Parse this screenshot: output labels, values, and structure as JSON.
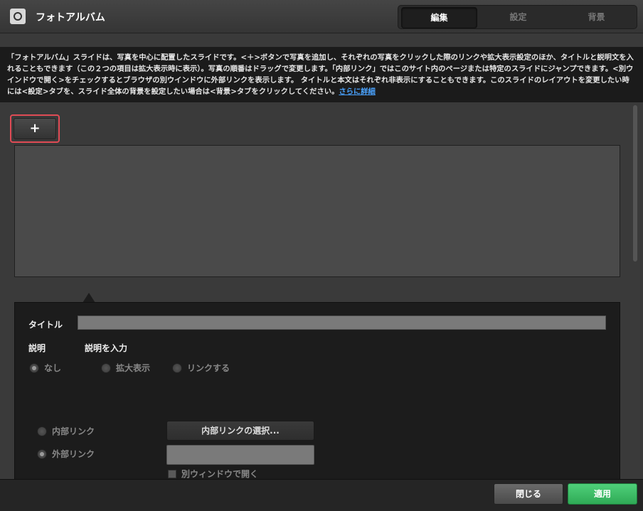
{
  "window": {
    "title": "フォトアルバム"
  },
  "tabs": [
    {
      "label": "編集"
    },
    {
      "label": "設定"
    },
    {
      "label": "背景"
    }
  ],
  "info": {
    "text": "「フォトアルバム」スライドは、写真を中心に配置したスライドです。<＋>ボタンで写真を追加し、それぞれの写真をクリックした際のリンクや拡大表示設定のほか、タイトルと説明文を入れることもできます（この２つの項目は拡大表示時に表示）。写真の順番はドラッグで変更します。「内部リンク」ではこのサイト内のページまたは特定のスライドにジャンプできます。<別ウインドウで開く>をチェックするとブラウザの別ウインドウに外部リンクを表示します。 タイトルと本文はそれぞれ非表示にすることもできます。このスライドのレイアウトを変更したい時には<設定>タブを、スライド全体の背景を設定したい場合は<背景>タブをクリックしてください。",
    "more_link": "さらに詳細"
  },
  "add_button": {
    "label": "+",
    "icon": "plus-icon"
  },
  "form": {
    "title_label": "タイトル",
    "description_label": "説明",
    "description_placeholder": "説明を入力",
    "click_action_options": [
      "なし",
      "拡大表示",
      "リンクする"
    ],
    "selected_click_action": "なし",
    "link_type_options": [
      "内部リンク",
      "外部リンク"
    ],
    "selected_link_type": "外部リンク",
    "internal_link_button": "内部リンクの選択...",
    "external_url_value": "",
    "new_window_label": "別ウィンドウで開く",
    "new_window_checked": false
  },
  "footer": {
    "close_label": "閉じる",
    "apply_label": "適用"
  },
  "colors": {
    "accent_red": "#e04b55",
    "apply_green": "#3cbf66",
    "link_blue": "#4aa3ff"
  }
}
